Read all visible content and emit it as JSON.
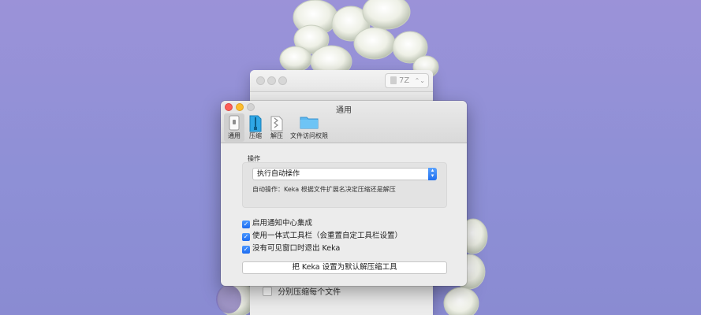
{
  "back_window": {
    "format_label": "7Z",
    "separate_option": "分别压缩每个文件"
  },
  "window": {
    "title": "通用",
    "toolbar": [
      {
        "label": "通用",
        "icon": "switch-icon",
        "selected": true
      },
      {
        "label": "压缩",
        "icon": "compress-icon",
        "selected": false
      },
      {
        "label": "解压",
        "icon": "extract-icon",
        "selected": false
      },
      {
        "label": "文件访问权限",
        "icon": "folder-icon",
        "selected": false
      }
    ],
    "action_section": {
      "label": "操作",
      "popup_value": "执行自动操作",
      "description": "自动操作：Keka 根据文件扩展名决定压缩还是解压"
    },
    "checkboxes": [
      {
        "label": "启用通知中心集成",
        "checked": true
      },
      {
        "label": "使用一体式工具栏（会重置自定工具栏设置）",
        "checked": true
      },
      {
        "label": "没有可见窗口时退出 Keka",
        "checked": true
      }
    ],
    "default_button": "把 Keka 设置为默认解压缩工具"
  },
  "colors": {
    "accent": "#1f6fef",
    "close": "#fc5f57",
    "minimize": "#fdbc2e",
    "background": "#9b92d8"
  }
}
